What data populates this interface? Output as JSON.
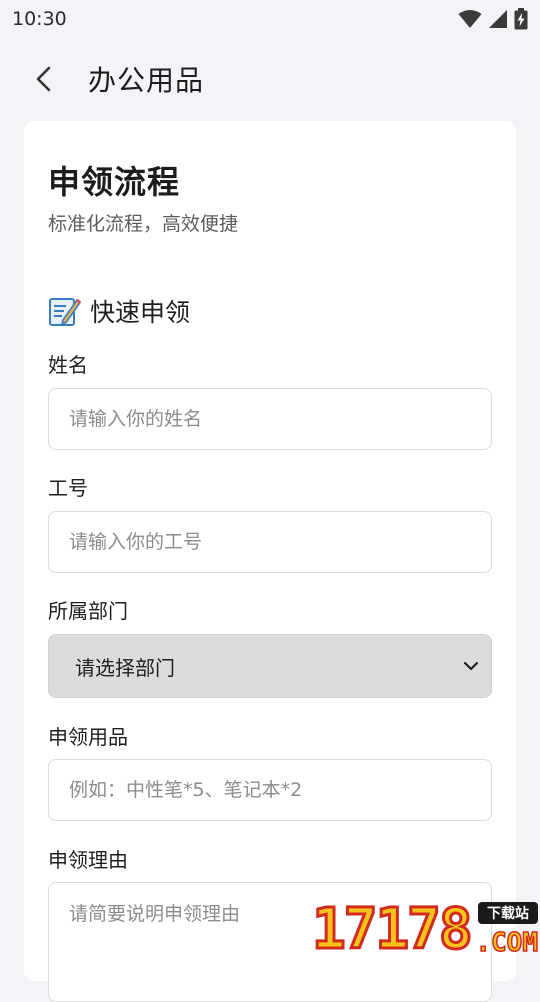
{
  "status_bar": {
    "time": "10:30"
  },
  "app_bar": {
    "title": "办公用品"
  },
  "card": {
    "title": "申领流程",
    "subtitle": "标准化流程，高效便捷",
    "section_title": "快速申领"
  },
  "form": {
    "name": {
      "label": "姓名",
      "placeholder": "请输入你的姓名"
    },
    "employee_id": {
      "label": "工号",
      "placeholder": "请输入你的工号"
    },
    "department": {
      "label": "所属部门",
      "selected": "请选择部门"
    },
    "items": {
      "label": "申领用品",
      "placeholder": "例如：中性笔*5、笔记本*2"
    },
    "reason": {
      "label": "申领理由",
      "placeholder": "请简要说明申领理由"
    }
  },
  "watermark": {
    "digits": "17178",
    "badge": "下载站",
    "suffix": ".COM"
  },
  "icons": {
    "back": "back-arrow-icon",
    "wifi": "wifi-icon",
    "signal": "signal-icon",
    "battery": "battery-charging-icon",
    "section": "notepad-pencil-icon",
    "dropdown": "chevron-down-icon"
  }
}
